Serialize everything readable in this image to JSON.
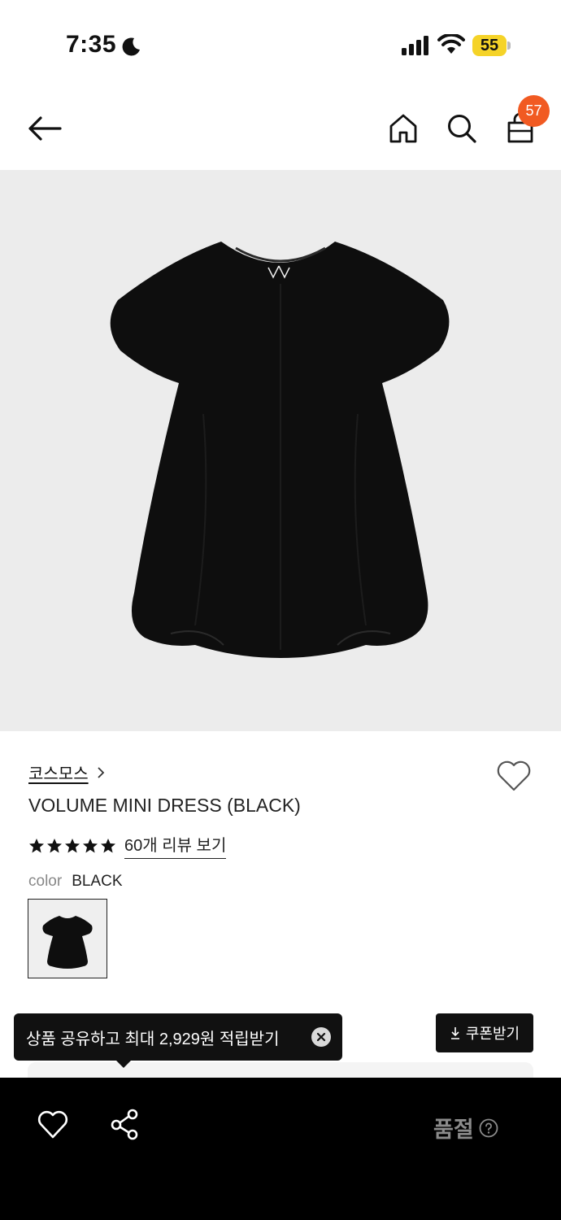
{
  "status_bar": {
    "time": "7:35",
    "battery": "55",
    "icons": [
      "moon-icon",
      "signal-icon",
      "wifi-icon",
      "battery-icon"
    ]
  },
  "nav": {
    "icons": [
      "back-arrow-icon",
      "home-icon",
      "search-icon",
      "shopping-bag-icon"
    ],
    "cart_count": "57"
  },
  "product": {
    "brand": "코스모스",
    "name": "VOLUME MINI DRESS (BLACK)",
    "rating_stars": 5,
    "review_link": "60개 리뷰 보기",
    "color_label": "color",
    "color_value": "BLACK"
  },
  "promo": {
    "share_tooltip": "상품 공유하고 최대 2,929원 적립받기",
    "coupon_button": "쿠폰받기"
  },
  "bottom_bar": {
    "status": "품절",
    "icons": [
      "heart-icon",
      "share-icon",
      "help-icon"
    ]
  },
  "colors": {
    "badge": "#f15a22",
    "battery": "#f5d328",
    "hero_bg": "#ececec",
    "bottom_bar": "#000000",
    "soldout_text": "#8b8b8b"
  }
}
